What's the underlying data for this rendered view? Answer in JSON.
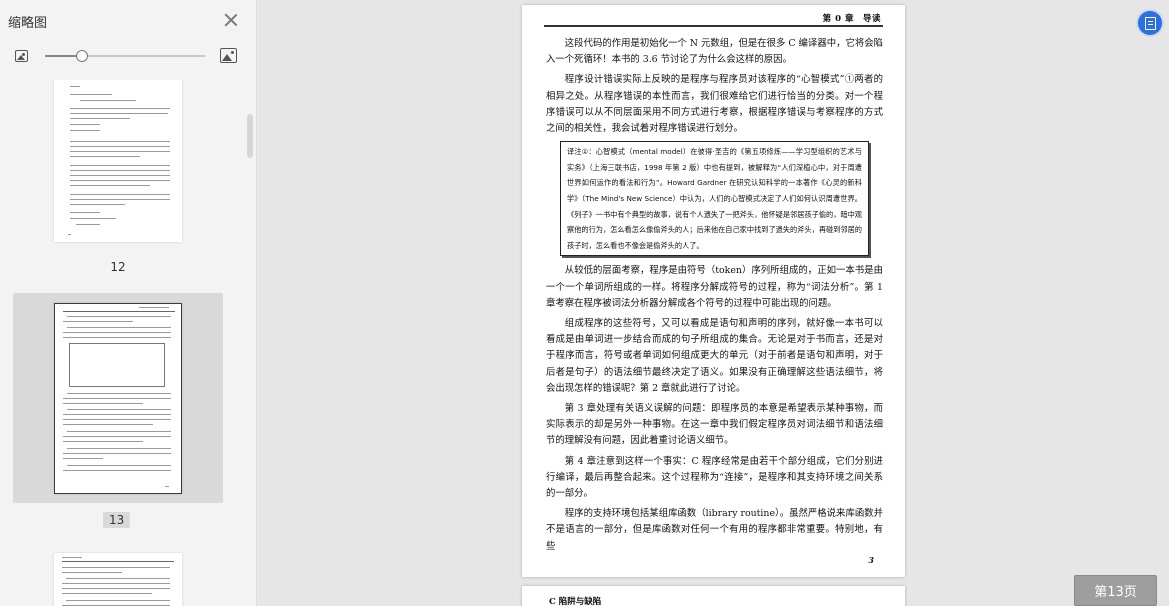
{
  "sidebar": {
    "title": "缩略图",
    "zoom_fraction": 0.23,
    "thumbnails": [
      {
        "label": "12",
        "selected": false
      },
      {
        "label": "13",
        "selected": true
      },
      {
        "label": "",
        "selected": false
      }
    ]
  },
  "page": {
    "header": "第 0 章　导读",
    "paragraphs": [
      "这段代码的作用是初始化一个 N 元数组，但是在很多 C 编译器中，它将会陷入一个死循环！本书的 3.6 节讨论了为什么会这样的原因。",
      "程序设计错误实际上反映的是程序与程序员对该程序的“心智模式”①两者的相异之处。从程序错误的本性而言，我们很难给它们进行恰当的分类。对一个程序错误可以从不同层面采用不同方式进行考察，根据程序错误与考察程序的方式之间的相关性，我会试着对程序错误进行划分。"
    ],
    "note": "译注①：心智模式（mental model）在彼得·圣吉的《第五项修炼——学习型组织的艺术与实务》（上海三联书店，1998 年第 2 版）中也有提到，被解释为“人们深植心中，对于周遭世界如何运作的看法和行为”。Howard Gardner 在研究认知科学的一本著作《心灵的新科学》（The Mind's New Science）中认为，人们的心智模式决定了人们如何认识周遭世界。《列子》一书中有个典型的故事，说有个人遗失了一把斧头，他怀疑是邻居孩子偷的，暗中观察他的行为，怎么看怎么像偷斧头的人；后来他在自己家中找到了遗失的斧头，再碰到邻居的孩子时，怎么看也不像会是偷斧头的人了。",
    "paragraphs2": [
      "从较低的层面考察，程序是由符号（token）序列所组成的，正如一本书是由一个一个单词所组成的一样。将程序分解成符号的过程，称为“词法分析”。第 1 章考察在程序被词法分析器分解成各个符号的过程中可能出现的问题。",
      "组成程序的这些符号，又可以看成是语句和声明的序列，就好像一本书可以看成是由单词进一步结合而成的句子所组成的集合。无论是对于书而言，还是对于程序而言，符号或者单词如何组成更大的单元（对于前者是语句和声明，对于后者是句子）的语法细节最终决定了语义。如果没有正确理解这些语法细节，将会出现怎样的错误呢？第 2 章就此进行了讨论。",
      "第 3 章处理有关语义误解的问题：即程序员的本意是希望表示某种事物，而实际表示的却是另外一种事物。在这一章中我们假定程序员对词法细节和语法细节的理解没有问题，因此着重讨论语义细节。",
      "第 4 章注意到这样一个事实：C 程序经常是由若干个部分组成，它们分别进行编译，最后再整合起来。这个过程称为“连接”，是程序和其支持环境之间关系的一部分。",
      "程序的支持环境包括某组库函数（library routine）。虽然严格说来库函数并不是语言的一部分，但是库函数对任何一个有用的程序都非常重要。特别地，有些"
    ],
    "page_number": "3"
  },
  "next_page": {
    "header": "C 陷阱与缺陷"
  },
  "page_indicator": "第13页"
}
